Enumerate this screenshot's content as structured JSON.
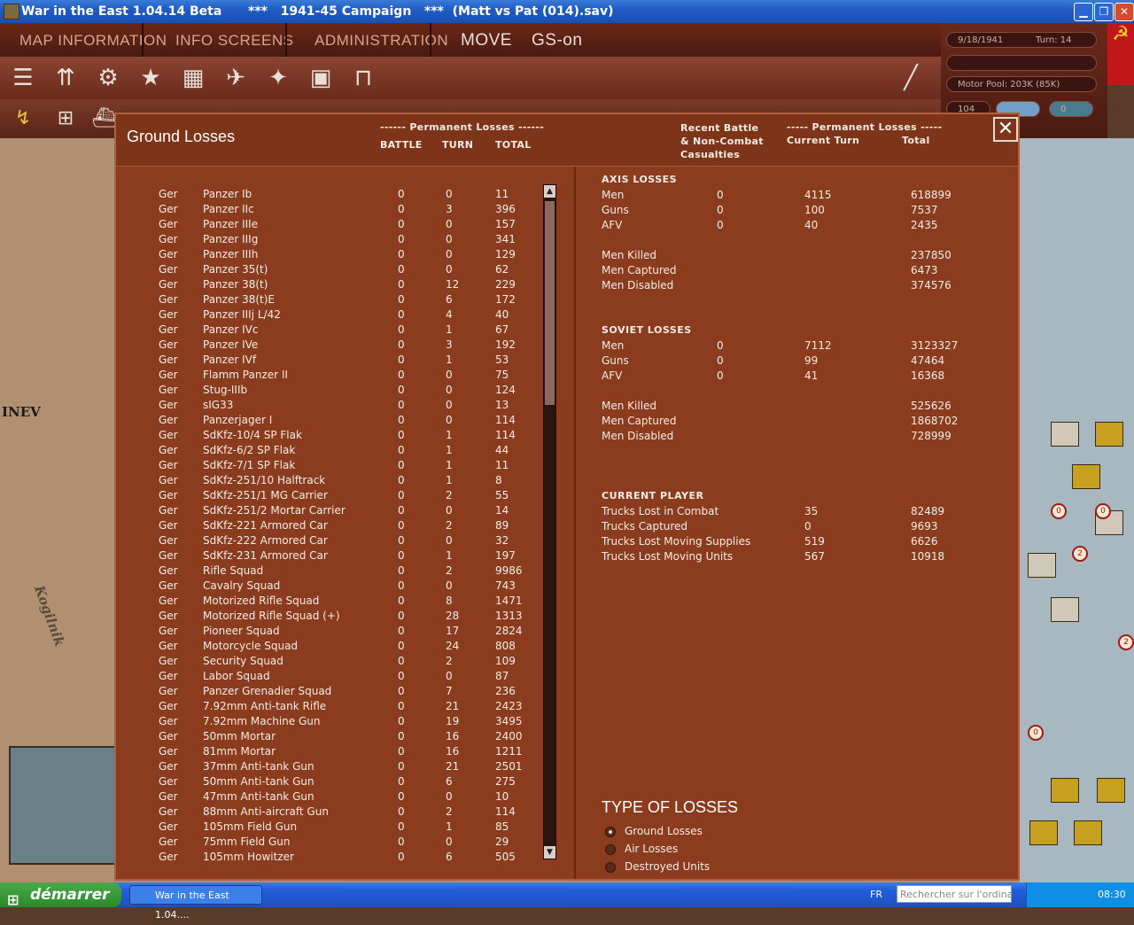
{
  "window": {
    "title": "War in the East 1.04.14 Beta",
    "subtitle": "***   1941-45 Campaign   ***  (Matt vs Pat (014).sav)"
  },
  "menu": {
    "map_info": "MAP INFORMATION",
    "info_screens": "INFO SCREENS",
    "administration": "ADMINISTRATION",
    "move": "MOVE",
    "gs": "GS-on"
  },
  "info": {
    "date": "9/18/1941",
    "turn": "Turn: 14",
    "motor_pool": "Motor Pool:  203K (85K)",
    "value": "104",
    "counter": "0"
  },
  "map": {
    "city": "INEV",
    "river": "Kogilnik"
  },
  "dialog": {
    "title": "Ground Losses",
    "left_group_header": "------ Permanent Losses ------",
    "col_battle": "BATTLE",
    "col_turn": "TURN",
    "col_total": "TOTAL",
    "recent_header": "Recent Battle\n& Non-Combat\nCasualties",
    "right_group_header": "----- Permanent Losses -----",
    "col_current_turn": "Current Turn",
    "col_right_total": "Total"
  },
  "ground_losses": [
    {
      "side": "Ger",
      "name": "Panzer Ib",
      "battle": "0",
      "turn": "0",
      "total": "11"
    },
    {
      "side": "Ger",
      "name": "Panzer IIc",
      "battle": "0",
      "turn": "3",
      "total": "396"
    },
    {
      "side": "Ger",
      "name": "Panzer IIIe",
      "battle": "0",
      "turn": "0",
      "total": "157"
    },
    {
      "side": "Ger",
      "name": "Panzer IIIg",
      "battle": "0",
      "turn": "0",
      "total": "341"
    },
    {
      "side": "Ger",
      "name": "Panzer IIIh",
      "battle": "0",
      "turn": "0",
      "total": "129"
    },
    {
      "side": "Ger",
      "name": "Panzer 35(t)",
      "battle": "0",
      "turn": "0",
      "total": "62"
    },
    {
      "side": "Ger",
      "name": "Panzer 38(t)",
      "battle": "0",
      "turn": "12",
      "total": "229"
    },
    {
      "side": "Ger",
      "name": "Panzer 38(t)E",
      "battle": "0",
      "turn": "6",
      "total": "172"
    },
    {
      "side": "Ger",
      "name": "Panzer IIIj L/42",
      "battle": "0",
      "turn": "4",
      "total": "40"
    },
    {
      "side": "Ger",
      "name": "Panzer IVc",
      "battle": "0",
      "turn": "1",
      "total": "67"
    },
    {
      "side": "Ger",
      "name": "Panzer IVe",
      "battle": "0",
      "turn": "3",
      "total": "192"
    },
    {
      "side": "Ger",
      "name": "Panzer IVf",
      "battle": "0",
      "turn": "1",
      "total": "53"
    },
    {
      "side": "Ger",
      "name": "Flamm Panzer II",
      "battle": "0",
      "turn": "0",
      "total": "75"
    },
    {
      "side": "Ger",
      "name": "Stug-IIIb",
      "battle": "0",
      "turn": "0",
      "total": "124"
    },
    {
      "side": "Ger",
      "name": "sIG33",
      "battle": "0",
      "turn": "0",
      "total": "13"
    },
    {
      "side": "Ger",
      "name": "Panzerjager I",
      "battle": "0",
      "turn": "0",
      "total": "114"
    },
    {
      "side": "Ger",
      "name": "SdKfz-10/4 SP Flak",
      "battle": "0",
      "turn": "1",
      "total": "114"
    },
    {
      "side": "Ger",
      "name": "SdKfz-6/2 SP Flak",
      "battle": "0",
      "turn": "1",
      "total": "44"
    },
    {
      "side": "Ger",
      "name": "SdKfz-7/1 SP Flak",
      "battle": "0",
      "turn": "1",
      "total": "11"
    },
    {
      "side": "Ger",
      "name": "SdKfz-251/10 Halftrack",
      "battle": "0",
      "turn": "1",
      "total": "8"
    },
    {
      "side": "Ger",
      "name": "SdKfz-251/1 MG Carrier",
      "battle": "0",
      "turn": "2",
      "total": "55"
    },
    {
      "side": "Ger",
      "name": "SdKfz-251/2 Mortar Carrier",
      "battle": "0",
      "turn": "0",
      "total": "14"
    },
    {
      "side": "Ger",
      "name": "SdKfz-221 Armored Car",
      "battle": "0",
      "turn": "2",
      "total": "89"
    },
    {
      "side": "Ger",
      "name": "SdKfz-222 Armored Car",
      "battle": "0",
      "turn": "0",
      "total": "32"
    },
    {
      "side": "Ger",
      "name": "SdKfz-231 Armored Car",
      "battle": "0",
      "turn": "1",
      "total": "197"
    },
    {
      "side": "Ger",
      "name": "Rifle Squad",
      "battle": "0",
      "turn": "2",
      "total": "9986"
    },
    {
      "side": "Ger",
      "name": "Cavalry Squad",
      "battle": "0",
      "turn": "0",
      "total": "743"
    },
    {
      "side": "Ger",
      "name": "Motorized Rifle Squad",
      "battle": "0",
      "turn": "8",
      "total": "1471"
    },
    {
      "side": "Ger",
      "name": "Motorized Rifle Squad (+)",
      "battle": "0",
      "turn": "28",
      "total": "1313"
    },
    {
      "side": "Ger",
      "name": "Pioneer Squad",
      "battle": "0",
      "turn": "17",
      "total": "2824"
    },
    {
      "side": "Ger",
      "name": "Motorcycle Squad",
      "battle": "0",
      "turn": "24",
      "total": "808"
    },
    {
      "side": "Ger",
      "name": "Security Squad",
      "battle": "0",
      "turn": "2",
      "total": "109"
    },
    {
      "side": "Ger",
      "name": "Labor Squad",
      "battle": "0",
      "turn": "0",
      "total": "87"
    },
    {
      "side": "Ger",
      "name": "Panzer Grenadier Squad",
      "battle": "0",
      "turn": "7",
      "total": "236"
    },
    {
      "side": "Ger",
      "name": "7.92mm Anti-tank Rifle",
      "battle": "0",
      "turn": "21",
      "total": "2423"
    },
    {
      "side": "Ger",
      "name": "7.92mm Machine Gun",
      "battle": "0",
      "turn": "19",
      "total": "3495"
    },
    {
      "side": "Ger",
      "name": "50mm Mortar",
      "battle": "0",
      "turn": "16",
      "total": "2400"
    },
    {
      "side": "Ger",
      "name": "81mm Mortar",
      "battle": "0",
      "turn": "16",
      "total": "1211"
    },
    {
      "side": "Ger",
      "name": "37mm Anti-tank Gun",
      "battle": "0",
      "turn": "21",
      "total": "2501"
    },
    {
      "side": "Ger",
      "name": "50mm Anti-tank Gun",
      "battle": "0",
      "turn": "6",
      "total": "275"
    },
    {
      "side": "Ger",
      "name": "47mm Anti-tank Gun",
      "battle": "0",
      "turn": "0",
      "total": "10"
    },
    {
      "side": "Ger",
      "name": "88mm Anti-aircraft Gun",
      "battle": "0",
      "turn": "2",
      "total": "114"
    },
    {
      "side": "Ger",
      "name": "105mm Field Gun",
      "battle": "0",
      "turn": "1",
      "total": "85"
    },
    {
      "side": "Ger",
      "name": "75mm Field Gun",
      "battle": "0",
      "turn": "0",
      "total": "29"
    },
    {
      "side": "Ger",
      "name": "105mm Howitzer",
      "battle": "0",
      "turn": "6",
      "total": "505"
    }
  ],
  "axis": {
    "title": "AXIS LOSSES",
    "rows": [
      {
        "label": "Men",
        "recent": "0",
        "turn": "4115",
        "total": "618899"
      },
      {
        "label": "Guns",
        "recent": "0",
        "turn": "100",
        "total": "7537"
      },
      {
        "label": "AFV",
        "recent": "0",
        "turn": "40",
        "total": "2435"
      }
    ],
    "detail": [
      {
        "label": "Men Killed",
        "total": "237850"
      },
      {
        "label": "Men Captured",
        "total": "6473"
      },
      {
        "label": "Men Disabled",
        "total": "374576"
      }
    ]
  },
  "soviet": {
    "title": "SOVIET LOSSES",
    "rows": [
      {
        "label": "Men",
        "recent": "0",
        "turn": "7112",
        "total": "3123327"
      },
      {
        "label": "Guns",
        "recent": "0",
        "turn": "99",
        "total": "47464"
      },
      {
        "label": "AFV",
        "recent": "0",
        "turn": "41",
        "total": "16368"
      }
    ],
    "detail": [
      {
        "label": "Men Killed",
        "total": "525626"
      },
      {
        "label": "Men Captured",
        "total": "1868702"
      },
      {
        "label": "Men Disabled",
        "total": "728999"
      }
    ]
  },
  "current_player": {
    "title": "CURRENT PLAYER",
    "rows": [
      {
        "label": "Trucks Lost in Combat",
        "turn": "35",
        "total": "82489"
      },
      {
        "label": "Trucks Captured",
        "turn": "0",
        "total": "9693"
      },
      {
        "label": "Trucks Lost Moving Supplies",
        "turn": "519",
        "total": "6626"
      },
      {
        "label": "Trucks Lost Moving Units",
        "turn": "567",
        "total": "10918"
      }
    ]
  },
  "type_of_losses": {
    "title": "TYPE OF LOSSES",
    "options": [
      "Ground Losses",
      "Air Losses",
      "Destroyed Units"
    ],
    "selected": "Ground Losses"
  },
  "taskbar": {
    "start": "démarrer",
    "task": "War in the East 1.04....",
    "lang": "FR",
    "search_placeholder": "Rechercher sur l'ordinateur",
    "clock": "08:30"
  },
  "colors": {
    "dialog_bg": "#8c3c1e",
    "menubar": "#4a1a10",
    "taskbar": "#245edb",
    "text": "#f4ece4"
  }
}
